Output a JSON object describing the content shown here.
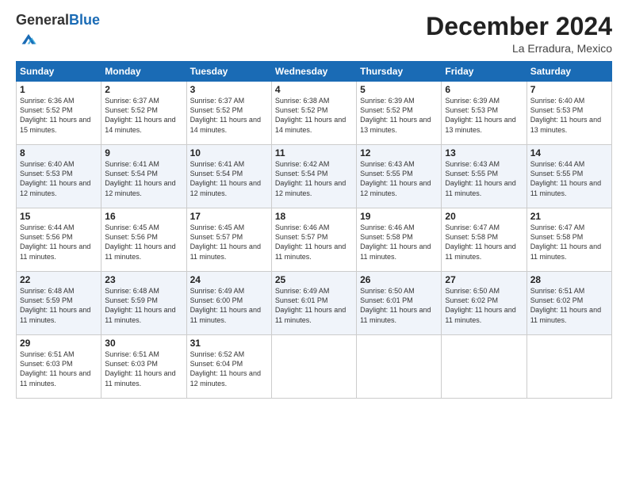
{
  "header": {
    "logo_general": "General",
    "logo_blue": "Blue",
    "month_title": "December 2024",
    "location": "La Erradura, Mexico"
  },
  "days_of_week": [
    "Sunday",
    "Monday",
    "Tuesday",
    "Wednesday",
    "Thursday",
    "Friday",
    "Saturday"
  ],
  "weeks": [
    [
      {
        "day": "1",
        "sunrise": "Sunrise: 6:36 AM",
        "sunset": "Sunset: 5:52 PM",
        "daylight": "Daylight: 11 hours and 15 minutes."
      },
      {
        "day": "2",
        "sunrise": "Sunrise: 6:37 AM",
        "sunset": "Sunset: 5:52 PM",
        "daylight": "Daylight: 11 hours and 14 minutes."
      },
      {
        "day": "3",
        "sunrise": "Sunrise: 6:37 AM",
        "sunset": "Sunset: 5:52 PM",
        "daylight": "Daylight: 11 hours and 14 minutes."
      },
      {
        "day": "4",
        "sunrise": "Sunrise: 6:38 AM",
        "sunset": "Sunset: 5:52 PM",
        "daylight": "Daylight: 11 hours and 14 minutes."
      },
      {
        "day": "5",
        "sunrise": "Sunrise: 6:39 AM",
        "sunset": "Sunset: 5:52 PM",
        "daylight": "Daylight: 11 hours and 13 minutes."
      },
      {
        "day": "6",
        "sunrise": "Sunrise: 6:39 AM",
        "sunset": "Sunset: 5:53 PM",
        "daylight": "Daylight: 11 hours and 13 minutes."
      },
      {
        "day": "7",
        "sunrise": "Sunrise: 6:40 AM",
        "sunset": "Sunset: 5:53 PM",
        "daylight": "Daylight: 11 hours and 13 minutes."
      }
    ],
    [
      {
        "day": "8",
        "sunrise": "Sunrise: 6:40 AM",
        "sunset": "Sunset: 5:53 PM",
        "daylight": "Daylight: 11 hours and 12 minutes."
      },
      {
        "day": "9",
        "sunrise": "Sunrise: 6:41 AM",
        "sunset": "Sunset: 5:54 PM",
        "daylight": "Daylight: 11 hours and 12 minutes."
      },
      {
        "day": "10",
        "sunrise": "Sunrise: 6:41 AM",
        "sunset": "Sunset: 5:54 PM",
        "daylight": "Daylight: 11 hours and 12 minutes."
      },
      {
        "day": "11",
        "sunrise": "Sunrise: 6:42 AM",
        "sunset": "Sunset: 5:54 PM",
        "daylight": "Daylight: 11 hours and 12 minutes."
      },
      {
        "day": "12",
        "sunrise": "Sunrise: 6:43 AM",
        "sunset": "Sunset: 5:55 PM",
        "daylight": "Daylight: 11 hours and 12 minutes."
      },
      {
        "day": "13",
        "sunrise": "Sunrise: 6:43 AM",
        "sunset": "Sunset: 5:55 PM",
        "daylight": "Daylight: 11 hours and 11 minutes."
      },
      {
        "day": "14",
        "sunrise": "Sunrise: 6:44 AM",
        "sunset": "Sunset: 5:55 PM",
        "daylight": "Daylight: 11 hours and 11 minutes."
      }
    ],
    [
      {
        "day": "15",
        "sunrise": "Sunrise: 6:44 AM",
        "sunset": "Sunset: 5:56 PM",
        "daylight": "Daylight: 11 hours and 11 minutes."
      },
      {
        "day": "16",
        "sunrise": "Sunrise: 6:45 AM",
        "sunset": "Sunset: 5:56 PM",
        "daylight": "Daylight: 11 hours and 11 minutes."
      },
      {
        "day": "17",
        "sunrise": "Sunrise: 6:45 AM",
        "sunset": "Sunset: 5:57 PM",
        "daylight": "Daylight: 11 hours and 11 minutes."
      },
      {
        "day": "18",
        "sunrise": "Sunrise: 6:46 AM",
        "sunset": "Sunset: 5:57 PM",
        "daylight": "Daylight: 11 hours and 11 minutes."
      },
      {
        "day": "19",
        "sunrise": "Sunrise: 6:46 AM",
        "sunset": "Sunset: 5:58 PM",
        "daylight": "Daylight: 11 hours and 11 minutes."
      },
      {
        "day": "20",
        "sunrise": "Sunrise: 6:47 AM",
        "sunset": "Sunset: 5:58 PM",
        "daylight": "Daylight: 11 hours and 11 minutes."
      },
      {
        "day": "21",
        "sunrise": "Sunrise: 6:47 AM",
        "sunset": "Sunset: 5:58 PM",
        "daylight": "Daylight: 11 hours and 11 minutes."
      }
    ],
    [
      {
        "day": "22",
        "sunrise": "Sunrise: 6:48 AM",
        "sunset": "Sunset: 5:59 PM",
        "daylight": "Daylight: 11 hours and 11 minutes."
      },
      {
        "day": "23",
        "sunrise": "Sunrise: 6:48 AM",
        "sunset": "Sunset: 5:59 PM",
        "daylight": "Daylight: 11 hours and 11 minutes."
      },
      {
        "day": "24",
        "sunrise": "Sunrise: 6:49 AM",
        "sunset": "Sunset: 6:00 PM",
        "daylight": "Daylight: 11 hours and 11 minutes."
      },
      {
        "day": "25",
        "sunrise": "Sunrise: 6:49 AM",
        "sunset": "Sunset: 6:01 PM",
        "daylight": "Daylight: 11 hours and 11 minutes."
      },
      {
        "day": "26",
        "sunrise": "Sunrise: 6:50 AM",
        "sunset": "Sunset: 6:01 PM",
        "daylight": "Daylight: 11 hours and 11 minutes."
      },
      {
        "day": "27",
        "sunrise": "Sunrise: 6:50 AM",
        "sunset": "Sunset: 6:02 PM",
        "daylight": "Daylight: 11 hours and 11 minutes."
      },
      {
        "day": "28",
        "sunrise": "Sunrise: 6:51 AM",
        "sunset": "Sunset: 6:02 PM",
        "daylight": "Daylight: 11 hours and 11 minutes."
      }
    ],
    [
      {
        "day": "29",
        "sunrise": "Sunrise: 6:51 AM",
        "sunset": "Sunset: 6:03 PM",
        "daylight": "Daylight: 11 hours and 11 minutes."
      },
      {
        "day": "30",
        "sunrise": "Sunrise: 6:51 AM",
        "sunset": "Sunset: 6:03 PM",
        "daylight": "Daylight: 11 hours and 11 minutes."
      },
      {
        "day": "31",
        "sunrise": "Sunrise: 6:52 AM",
        "sunset": "Sunset: 6:04 PM",
        "daylight": "Daylight: 11 hours and 12 minutes."
      },
      null,
      null,
      null,
      null
    ]
  ]
}
